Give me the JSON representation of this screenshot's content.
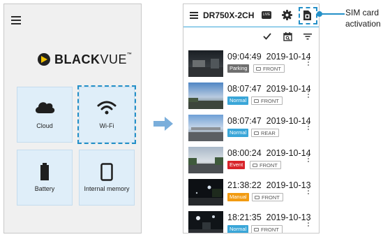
{
  "left_screen": {
    "logo": {
      "text_bold": "BLACK",
      "text_light": "VUE",
      "tm": "™"
    },
    "tiles": [
      {
        "label": "Cloud",
        "icon": "cloud-icon"
      },
      {
        "label": "Wi-Fi",
        "icon": "wifi-icon"
      },
      {
        "label": "Battery",
        "icon": "battery-icon"
      },
      {
        "label": "Internal memory",
        "icon": "phone-memory-icon"
      }
    ]
  },
  "right_screen": {
    "header": {
      "model": "DR750X-2CH",
      "live_label": "LIVE"
    },
    "recordings": [
      {
        "time": "09:04:49",
        "date": "2019-10-14",
        "mode": "Parking",
        "mode_color": "#6f6f6f",
        "camera": "FRONT"
      },
      {
        "time": "08:07:47",
        "date": "2019-10-14",
        "mode": "Normal",
        "mode_color": "#3aa6d8",
        "camera": "FRONT"
      },
      {
        "time": "08:07:47",
        "date": "2019-10-14",
        "mode": "Normal",
        "mode_color": "#3aa6d8",
        "camera": "REAR"
      },
      {
        "time": "08:00:24",
        "date": "2019-10-14",
        "mode": "Event",
        "mode_color": "#d8232a",
        "camera": "FRONT"
      },
      {
        "time": "21:38:22",
        "date": "2019-10-13",
        "mode": "Manual",
        "mode_color": "#f29b11",
        "camera": "FRONT"
      },
      {
        "time": "18:21:35",
        "date": "2019-10-13",
        "mode": "Normal",
        "mode_color": "#3aa6d8",
        "camera": "FRONT"
      }
    ]
  },
  "callout": {
    "line1": "SIM card",
    "line2": "activation"
  },
  "colors": {
    "highlight": "#2490c8",
    "tile_bg": "#dfeef9",
    "accent": "#3aa6d8"
  }
}
